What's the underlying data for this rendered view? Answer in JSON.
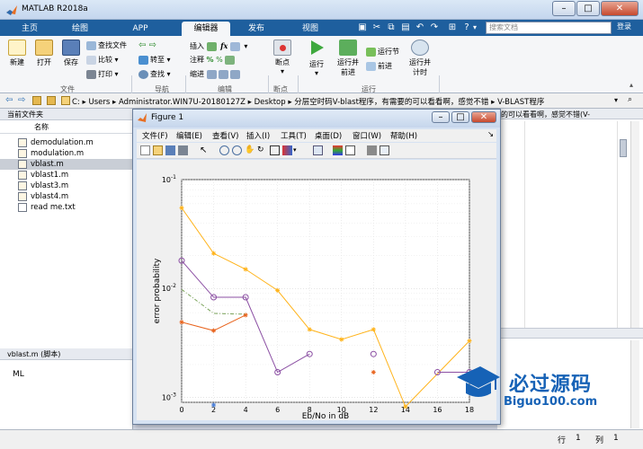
{
  "app": {
    "title": "MATLAB R2018a"
  },
  "tabs": [
    {
      "label": "主页"
    },
    {
      "label": "绘图"
    },
    {
      "label": "APP"
    },
    {
      "label": "编辑器"
    },
    {
      "label": "发布"
    },
    {
      "label": "视图"
    }
  ],
  "search": {
    "placeholder": "搜索文档",
    "side": "登录"
  },
  "ribbon": {
    "new": "新建",
    "open": "打开",
    "save": "保存",
    "find_files": "查找文件",
    "compare": "比较",
    "print": "打印",
    "goto": "转至",
    "find": "查找",
    "insert": "插入",
    "comment": "注释",
    "indent": "缩进",
    "breakpoints": "断点",
    "run": "运行",
    "run_advance": "运行并\n前进",
    "run_section": "运行节",
    "advance": "前进",
    "run_time": "运行并\n计时",
    "groups": {
      "file": "文件",
      "nav": "导航",
      "edit": "编辑",
      "bp": "断点",
      "run": "运行"
    }
  },
  "address": {
    "path": [
      "C:",
      "Users",
      "Administrator.WIN7U-20180127Z",
      "Desktop",
      "分层空时码V-blast程序，有需要的可以看看啊，感觉不错",
      "V-BLAST程序"
    ],
    "behind_text": "的可以看看啊，感觉不错(V-"
  },
  "left_panel": {
    "header": "当前文件夹",
    "column": "名称",
    "files": [
      {
        "name": "demodulation.m"
      },
      {
        "name": "modulation.m"
      },
      {
        "name": "vblast.m"
      },
      {
        "name": "vblast1.m"
      },
      {
        "name": "vblast3.m"
      },
      {
        "name": "vblast4.m"
      },
      {
        "name": "read me.txt"
      }
    ],
    "details_header": "vblast.m  (脚本)",
    "details_text": "ML"
  },
  "status": {
    "row_label": "行",
    "row_value": "1",
    "col_label": "列",
    "col_value": "1"
  },
  "figure": {
    "title": "Figure 1",
    "menu": [
      "文件(F)",
      "编辑(E)",
      "查看(V)",
      "插入(I)",
      "工具(T)",
      "桌面(D)",
      "窗口(W)",
      "帮助(H)"
    ]
  },
  "watermark": {
    "cn": "必过源码",
    "url": "Biguo100.com"
  },
  "colors": {
    "orange": "#ffb31a",
    "purple": "#8b4fa3",
    "red": "#e8641e",
    "green": "#7aa35a",
    "blue": "#4a7fd8"
  },
  "chart_data": {
    "type": "line",
    "xlabel": "Eb/No in dB",
    "ylabel": "error probability",
    "yscale": "log",
    "xlim": [
      0,
      18
    ],
    "ylim": [
      0.0009,
      0.1
    ],
    "xticks": [
      "0",
      "2",
      "4",
      "6",
      "8",
      "10",
      "12",
      "14",
      "16",
      "18"
    ],
    "yticks": [
      {
        "value": 0.1,
        "base": "10",
        "exp": "-1"
      },
      {
        "value": 0.01,
        "base": "10",
        "exp": "-2"
      },
      {
        "value": 0.001,
        "base": "10",
        "exp": "-3"
      }
    ],
    "grid": true,
    "series": [
      {
        "color": "#ffb31a",
        "marker": "star",
        "segments": [
          [
            [
              0,
              0.055
            ],
            [
              2,
              0.021
            ],
            [
              4,
              0.015
            ],
            [
              6,
              0.0096
            ],
            [
              8,
              0.0042
            ],
            [
              10,
              0.0034
            ],
            [
              12,
              0.0042
            ],
            [
              14,
              0.00082
            ],
            [
              18,
              0.0033
            ]
          ]
        ]
      },
      {
        "color": "#8b4fa3",
        "marker": "circle",
        "segments": [
          [
            [
              0,
              0.018
            ],
            [
              2,
              0.0083
            ],
            [
              4,
              0.0083
            ],
            [
              6,
              0.0017
            ],
            [
              8,
              0.0025
            ]
          ],
          [
            [
              12,
              0.0025
            ]
          ],
          [
            [
              16,
              0.0017
            ],
            [
              18,
              0.0017
            ]
          ]
        ]
      },
      {
        "color": "#e8641e",
        "marker": "star",
        "segments": [
          [
            [
              0,
              0.0049
            ],
            [
              2,
              0.0041
            ],
            [
              4,
              0.0057
            ]
          ],
          [
            [
              12,
              0.0017
            ]
          ]
        ]
      },
      {
        "color": "#7aa35a",
        "marker": "none",
        "dash": "4,2,1,2",
        "segments": [
          [
            [
              0,
              0.0098
            ],
            [
              2,
              0.0059
            ],
            [
              4,
              0.0058
            ]
          ]
        ]
      },
      {
        "color": "#4a7fd8",
        "marker": "star",
        "segments": [
          [
            [
              2,
              0.00085
            ]
          ]
        ]
      }
    ]
  }
}
